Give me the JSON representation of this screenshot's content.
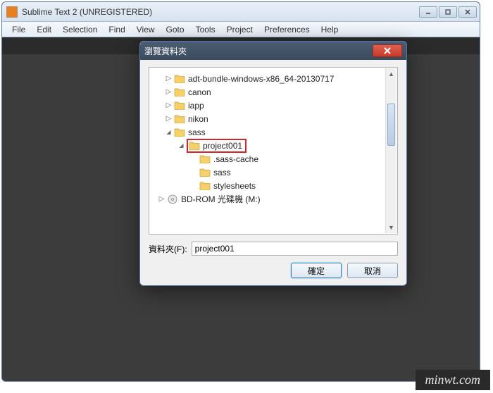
{
  "window": {
    "title": "Sublime Text 2 (UNREGISTERED)"
  },
  "menu": {
    "items": [
      "File",
      "Edit",
      "Selection",
      "Find",
      "View",
      "Goto",
      "Tools",
      "Project",
      "Preferences",
      "Help"
    ]
  },
  "dialog": {
    "title": "瀏覽資料夾",
    "tree": [
      {
        "indent": 0,
        "expanded": false,
        "type": "folder",
        "label": "adt-bundle-windows-x86_64-20130717"
      },
      {
        "indent": 0,
        "expanded": false,
        "type": "folder",
        "label": "canon"
      },
      {
        "indent": 0,
        "expanded": false,
        "type": "folder",
        "label": "iapp"
      },
      {
        "indent": 0,
        "expanded": false,
        "type": "folder",
        "label": "nikon"
      },
      {
        "indent": 0,
        "expanded": true,
        "type": "folder",
        "label": "sass"
      },
      {
        "indent": 1,
        "expanded": true,
        "type": "folder",
        "label": "project001",
        "highlight": true
      },
      {
        "indent": 2,
        "expanded": null,
        "type": "folder",
        "label": ".sass-cache"
      },
      {
        "indent": 2,
        "expanded": null,
        "type": "folder",
        "label": "sass"
      },
      {
        "indent": 2,
        "expanded": null,
        "type": "folder",
        "label": "stylesheets"
      },
      {
        "indent": -1,
        "expanded": false,
        "type": "disc",
        "label": "BD-ROM 光碟機 (M:)"
      }
    ],
    "field_label": "資料夾(F):",
    "field_value": "project001",
    "ok_label": "確定",
    "cancel_label": "取消"
  },
  "watermark": "minwt.com"
}
